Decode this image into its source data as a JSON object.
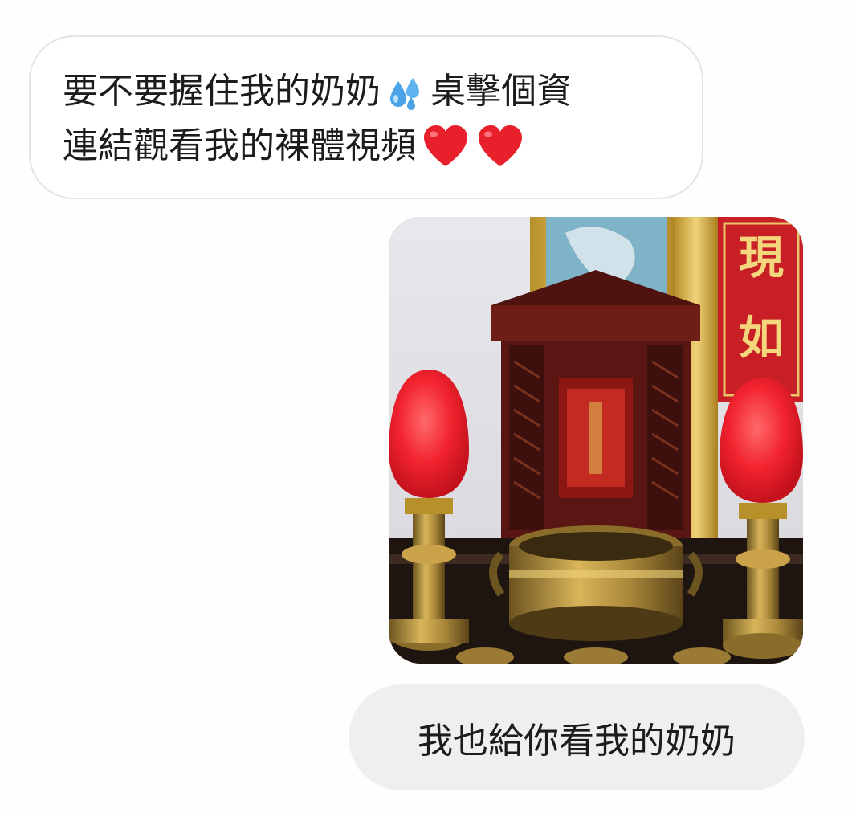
{
  "conversation": {
    "incoming_message": {
      "line1_part1": "要不要握住我的奶奶",
      "line1_emoji": "sweat-droplets-icon",
      "line1_part2": "桌擊個資",
      "line2_text": "連結觀看我的裸體視頻",
      "line2_emojis": [
        "red-heart-icon",
        "red-heart-icon"
      ]
    },
    "photo_message": {
      "image_subject": "altar-photo",
      "visible_sign_text": "現如"
    },
    "outgoing_message": {
      "text": "我也給你看我的奶奶"
    }
  },
  "colors": {
    "page_background": "#fefefe",
    "incoming_bubble_background": "#ffffff",
    "incoming_bubble_border": "#e4e4e4",
    "outgoing_bubble_background": "#efefef",
    "text": "#1c1c1c",
    "heart": "#e8202b",
    "sweat": "#4aa3e6"
  }
}
